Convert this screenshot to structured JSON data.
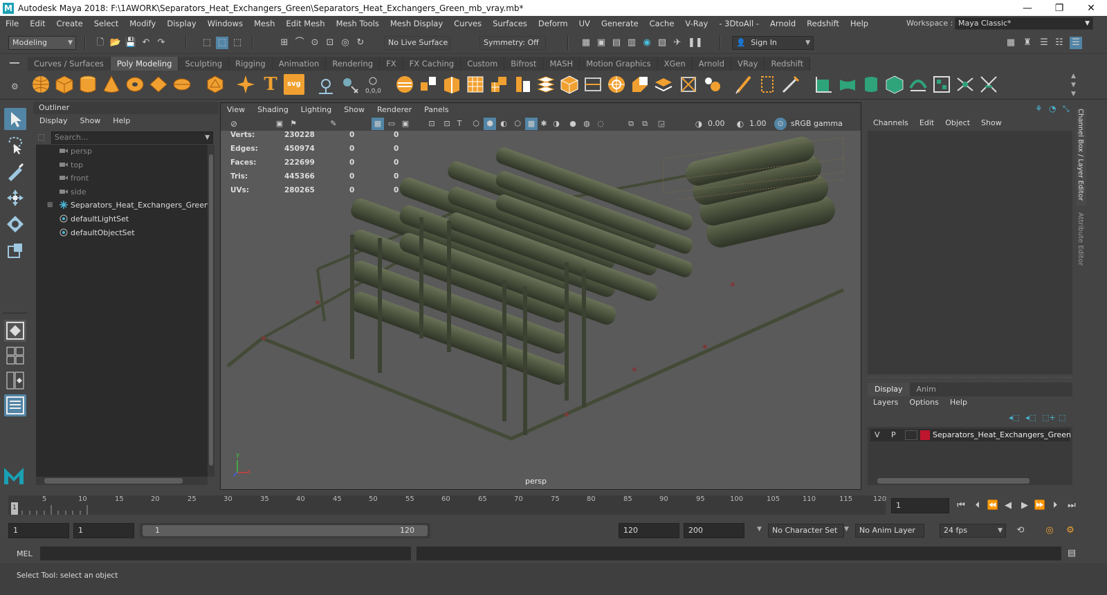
{
  "window": {
    "title": "Autodesk Maya 2018: F:\\1AWORK\\Separators_Heat_Exchangers_Green\\Separators_Heat_Exchangers_Green_mb_vray.mb*",
    "logo": "M",
    "buttons": {
      "minimize": "—",
      "restore": "❐",
      "close": "✕"
    }
  },
  "menubar": {
    "items": [
      "File",
      "Edit",
      "Create",
      "Select",
      "Modify",
      "Display",
      "Windows",
      "Mesh",
      "Edit Mesh",
      "Mesh Tools",
      "Mesh Display",
      "Curves",
      "Surfaces",
      "Deform",
      "UV",
      "Generate",
      "Cache",
      "V-Ray",
      "- 3DtoAll -",
      "Arnold",
      "Redshift",
      "Help"
    ],
    "workspace_label": "Workspace :",
    "workspace_value": "Maya Classic*"
  },
  "statusline": {
    "mode": "Modeling",
    "live_surface": "No Live Surface",
    "symmetry": "Symmetry: Off",
    "sign_in": "Sign In"
  },
  "shelf": {
    "tabs": [
      "Curves / Surfaces",
      "Poly Modeling",
      "Sculpting",
      "Rigging",
      "Animation",
      "Rendering",
      "FX",
      "FX Caching",
      "Custom",
      "Bifrost",
      "MASH",
      "Motion Graphics",
      "XGen",
      "Arnold",
      "VRay",
      "Redshift"
    ],
    "active_tab": "Poly Modeling",
    "text_icon": "T",
    "svg_icon": "svg"
  },
  "outliner": {
    "title": "Outliner",
    "menus": [
      "Display",
      "Show",
      "Help"
    ],
    "search_placeholder": "Search...",
    "rows": [
      {
        "label": "persp",
        "dim": true
      },
      {
        "label": "top",
        "dim": true
      },
      {
        "label": "front",
        "dim": true
      },
      {
        "label": "side",
        "dim": true
      },
      {
        "label": "Separators_Heat_Exchangers_Green_nc",
        "dim": false
      },
      {
        "label": "defaultLightSet",
        "dim": false
      },
      {
        "label": "defaultObjectSet",
        "dim": false
      }
    ]
  },
  "viewport": {
    "menus": [
      "View",
      "Shading",
      "Lighting",
      "Show",
      "Renderer",
      "Panels"
    ],
    "exposure": "0.00",
    "gamma": "1.00",
    "color_space": "sRGB gamma",
    "camera_label": "persp",
    "hud": [
      {
        "label": "Verts:",
        "v1": "230228",
        "v2": "0",
        "v3": "0"
      },
      {
        "label": "Edges:",
        "v1": "450974",
        "v2": "0",
        "v3": "0"
      },
      {
        "label": "Faces:",
        "v1": "222699",
        "v2": "0",
        "v3": "0"
      },
      {
        "label": "Tris:",
        "v1": "445366",
        "v2": "0",
        "v3": "0"
      },
      {
        "label": "UVs:",
        "v1": "280265",
        "v2": "0",
        "v3": "0"
      }
    ],
    "axis": {
      "x": "x",
      "y": "y"
    }
  },
  "channelbox": {
    "menus": [
      "Channels",
      "Edit",
      "Object",
      "Show"
    ],
    "side_tab_1": "Channel Box / Layer Editor",
    "side_tab_2": "Attribute Editor"
  },
  "layer_editor": {
    "tabs": [
      "Display",
      "Anim"
    ],
    "menus": [
      "Layers",
      "Options",
      "Help"
    ],
    "layer": {
      "v": "V",
      "p": "P",
      "name": "Separators_Heat_Exchangers_Green",
      "color": "#c0152f"
    }
  },
  "timeline": {
    "ticks": [
      "5",
      "10",
      "15",
      "20",
      "25",
      "30",
      "35",
      "40",
      "45",
      "50",
      "55",
      "60",
      "65",
      "70",
      "75",
      "80",
      "85",
      "90",
      "95",
      "100",
      "105",
      "110",
      "115",
      "120"
    ],
    "current_marker": "1",
    "current_frame": "1"
  },
  "range": {
    "start": "1",
    "playback_start": "1",
    "slider_start": "1",
    "slider_end": "120",
    "playback_end": "120",
    "end": "200",
    "character_set": "No Character Set",
    "anim_layer": "No Anim Layer",
    "fps": "24 fps"
  },
  "command": {
    "label": "MEL"
  },
  "help": {
    "text": "Select Tool: select an object"
  },
  "colors": {
    "accent": "#5285a6",
    "model": "#4e5640",
    "active_tab": "#535353"
  }
}
